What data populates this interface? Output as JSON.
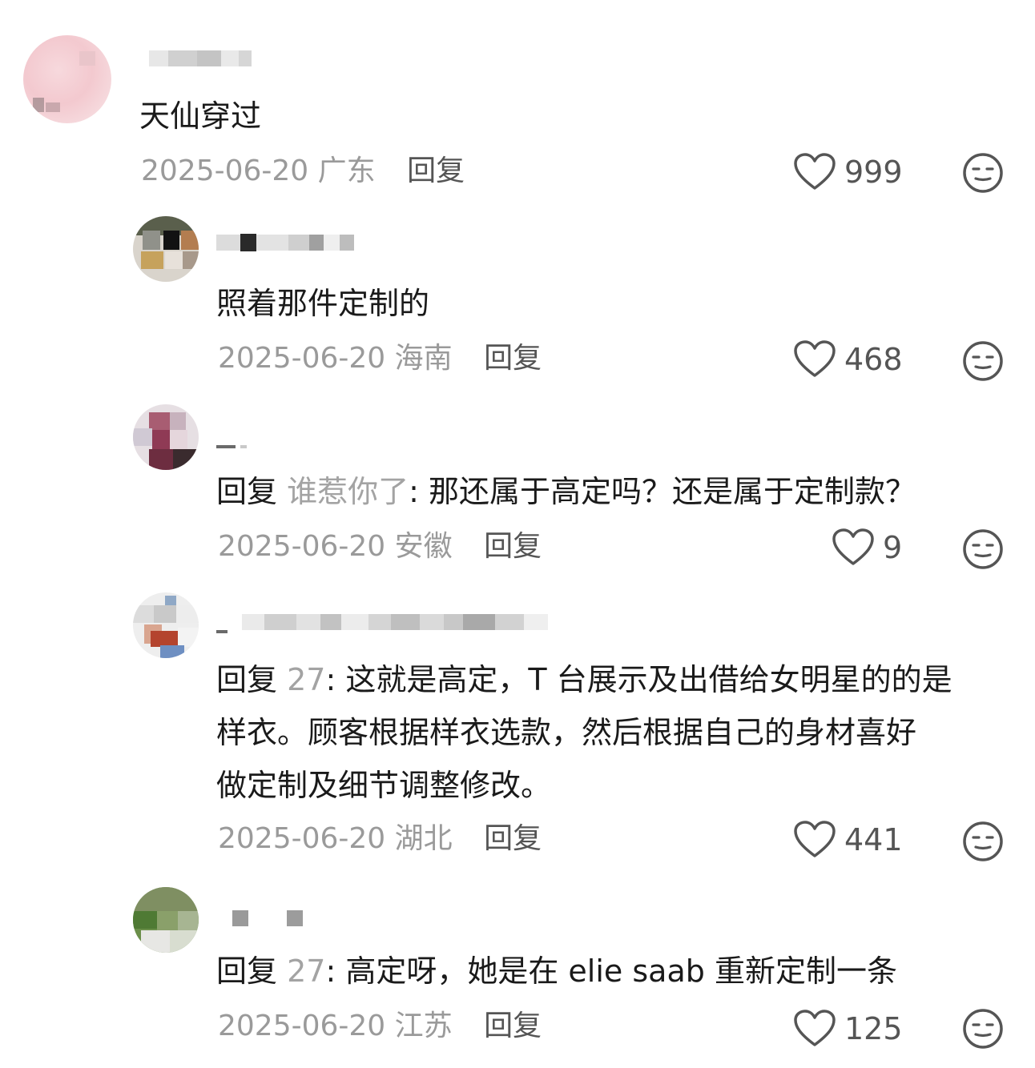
{
  "comments": [
    {
      "text": "天仙穿过",
      "date": "2025-06-20",
      "location": "广东",
      "reply_label": "回复",
      "likes": "999"
    },
    {
      "text": "照着那件定制的",
      "date": "2025-06-20",
      "location": "海南",
      "reply_label": "回复",
      "likes": "468"
    },
    {
      "reply_prefix": "回复",
      "reply_target": "谁惹你了",
      "text": ": 那还属于高定吗？还是属于定制款？",
      "date": "2025-06-20",
      "location": "安徽",
      "reply_label": "回复",
      "likes": "9"
    },
    {
      "reply_prefix": "回复",
      "reply_target": "27",
      "text_lines": [
        ": 这就是高定，T 台展示及出借给女明星的的是",
        "样衣。顾客根据样衣选款，然后根据自己的身材喜好",
        "做定制及细节调整修改。"
      ],
      "date": "2025-06-20",
      "location": "湖北",
      "reply_label": "回复",
      "likes": "441"
    },
    {
      "reply_prefix": "回复",
      "reply_target": "27",
      "text": ": 高定呀，她是在 elie saab 重新定制一条",
      "date": "2025-06-20",
      "location": "江苏",
      "reply_label": "回复",
      "likes": "125"
    }
  ],
  "colors": {
    "text": "#1a1a1a",
    "meta": "#9a9a9a",
    "reply_target": "#a3a3a3",
    "icon": "#555555"
  }
}
